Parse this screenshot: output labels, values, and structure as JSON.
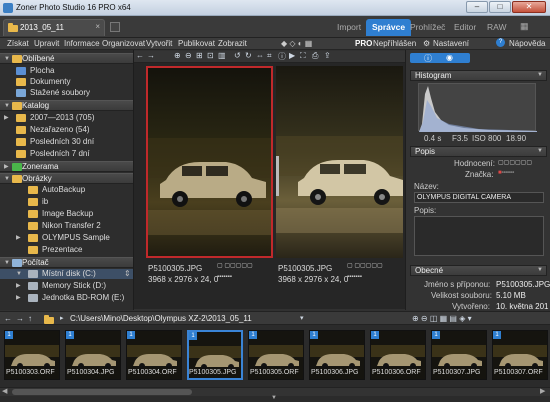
{
  "window": {
    "title": "Zoner Photo Studio 16 PRO x64",
    "min": "–",
    "max": "□",
    "close": "✕"
  },
  "tabs": {
    "document": "2013_05_11",
    "modes": [
      "Import",
      "Správce",
      "Prohlížeč",
      "Editor",
      "RAW"
    ]
  },
  "menu": [
    "Získat",
    "Upravit",
    "Informace",
    "Organizovat",
    "Vytvořit",
    "Publikovat",
    "Zobrazit"
  ],
  "right_menu": {
    "badge": "PRO",
    "unpublished": "Nepříhlášen",
    "settings": "Nastavení",
    "help": "Nápověda"
  },
  "sidebar": {
    "favorites": {
      "header": "Oblíbené",
      "items": [
        "Plocha",
        "Dokumenty",
        "Stažené soubory"
      ]
    },
    "catalog": {
      "header": "Katalog",
      "items": [
        "2007—2013 (705)",
        "Nezařazeno (54)",
        "Posledních 30 dní",
        "Posledních 7 dní"
      ]
    },
    "zonerama": {
      "header": "Zonerama"
    },
    "pictures": {
      "header": "Obrázky",
      "items": [
        "AutoBackup",
        "ib",
        "Image Backup",
        "Nikon Transfer 2",
        "OLYMPUS Sample",
        "Prezentace"
      ]
    },
    "computer": {
      "header": "Počítač",
      "items": [
        "Místní disk (C:)",
        "Memory Stick (D:)",
        "Jednotka BD-ROM (E:)"
      ]
    }
  },
  "viewer": {
    "left": {
      "filename": "P5100305.JPG",
      "info": "3968 x 2976 x 24, 0"
    },
    "right": {
      "filename": "P5100305.JPG",
      "info": "3968 x 2976 x 24, 0"
    }
  },
  "info_panel": {
    "histogram_header": "Histogram",
    "exif": {
      "shutter": "0.4 s",
      "aperture": "F3.5",
      "iso": "ISO 800",
      "focal": "18.90"
    },
    "description_header": "Popis",
    "rating_label": "Hodnocení:",
    "tag_label": "Značka:",
    "title_label": "Název:",
    "title_value": "OLYMPUS DIGITAL CAMERA",
    "desc_label": "Popis:",
    "general_header": "Obecné",
    "ext_label": "Jméno s příponou:",
    "ext_value": "P5100305.JPG",
    "size_label": "Velikost souboru:",
    "size_value": "5.10 MB",
    "created_label": "Vytvořeno:",
    "created_value": "10. května 201"
  },
  "path": "C:\\Users\\Mino\\Desktop\\Olympus XZ-2\\2013_05_11",
  "filmstrip": [
    {
      "name": "P5100303.ORF",
      "badge": "1"
    },
    {
      "name": "P5100304.JPG",
      "badge": "1"
    },
    {
      "name": "P5100304.ORF",
      "badge": "1"
    },
    {
      "name": "P5100305.JPG",
      "badge": "1"
    },
    {
      "name": "P5100305.ORF",
      "badge": "1"
    },
    {
      "name": "P5100306.JPG",
      "badge": "1"
    },
    {
      "name": "P5100306.ORF",
      "badge": "1"
    },
    {
      "name": "P5100307.JPG",
      "badge": "1"
    },
    {
      "name": "P5100307.ORF",
      "badge": "1"
    }
  ],
  "colors": {
    "accent": "#2f7fd1",
    "selection": "#3a84d6",
    "folder": "#e8b84b",
    "compare_border": "#c0292b"
  }
}
